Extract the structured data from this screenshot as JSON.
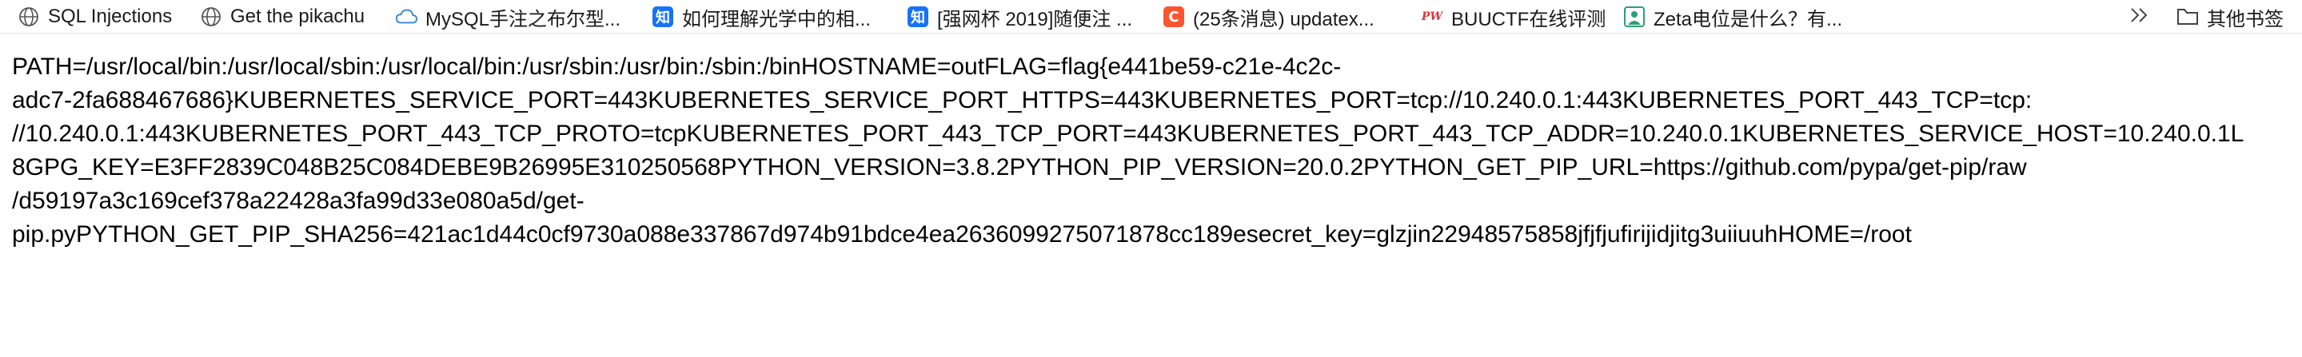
{
  "bookmarks": [
    {
      "label": "SQL Injections",
      "icon": "globe-icon"
    },
    {
      "label": "Get the pikachu",
      "icon": "globe-icon"
    },
    {
      "label": "MySQL手注之布尔型...",
      "icon": "cloud-icon"
    },
    {
      "label": "如何理解光学中的相...",
      "icon": "zhihu-icon",
      "badge": "知"
    },
    {
      "label": "[强网杯 2019]随便注 ...",
      "icon": "zhihu-icon",
      "badge": "知"
    },
    {
      "label": "(25条消息) updatex...",
      "icon": "csdn-icon",
      "badge": "C"
    },
    {
      "label": "BUUCTF在线评测",
      "icon": "buuctf-icon",
      "badge": "PW"
    },
    {
      "label": "Zeta电位是什么？有...",
      "icon": "person-icon"
    }
  ],
  "bookmarks_overflow_icon": "double-chevron-right-icon",
  "other_bookmarks": {
    "label": "其他书签",
    "icon": "folder-icon"
  },
  "colors": {
    "zhihu": "#1772f6",
    "csdn": "#fc5531",
    "buuctf": "#d9363e",
    "person": "#2e9e74",
    "cloud": "#3a86d9",
    "globe": "#555555"
  },
  "content": {
    "lines": [
      "PATH=/usr/local/bin:/usr/local/sbin:/usr/local/bin:/usr/sbin:/usr/bin:/sbin:/binHOSTNAME=outFLAG=flag{e441be59-c21e-4c2c-",
      "adc7-2fa688467686}KUBERNETES_SERVICE_PORT=443KUBERNETES_SERVICE_PORT_HTTPS=443KUBERNETES_PORT=tcp://10.240.0.1:443KUBERNETES_PORT_443_TCP=tcp:",
      "//10.240.0.1:443KUBERNETES_PORT_443_TCP_PROTO=tcpKUBERNETES_PORT_443_TCP_PORT=443KUBERNETES_PORT_443_TCP_ADDR=10.240.0.1KUBERNETES_SERVICE_HOST=10.240.0.1L",
      "8GPG_KEY=E3FF2839C048B25C084DEBE9B26995E310250568PYTHON_VERSION=3.8.2PYTHON_PIP_VERSION=20.0.2PYTHON_GET_PIP_URL=https://github.com/pypa/get-pip/raw",
      "/d59197a3c169cef378a22428a3fa99d33e080a5d/get-",
      "pip.pyPYTHON_GET_PIP_SHA256=421ac1d44c0cf9730a088e337867d974b91bdce4ea2636099275071878cc189esecret_key=glzjin22948575858jfjfjufirijidjitg3uiiuuhHOME=/root"
    ]
  }
}
